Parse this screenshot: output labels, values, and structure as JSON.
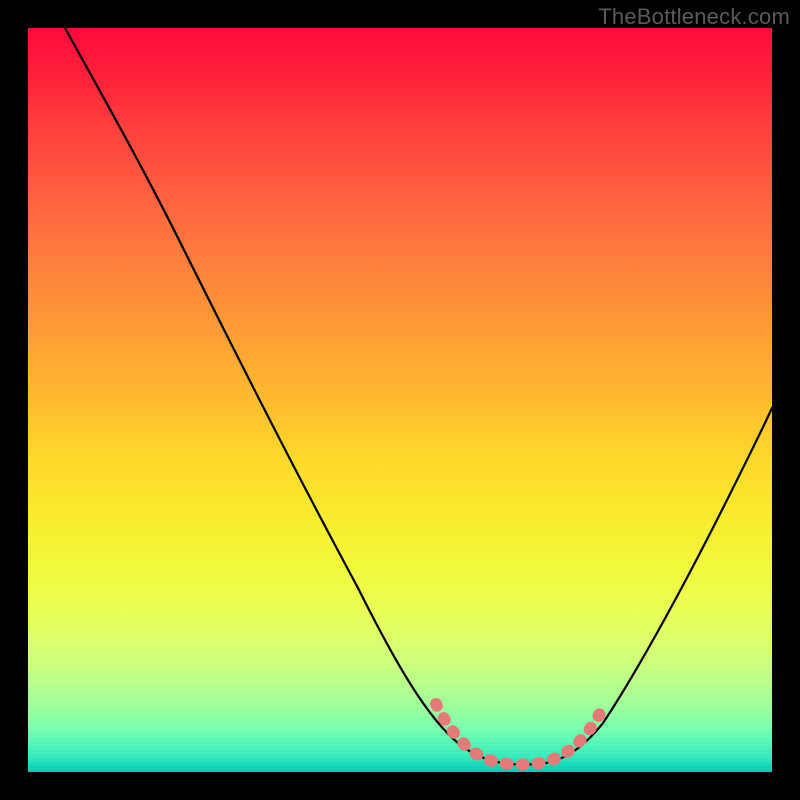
{
  "watermark": "TheBottleneck.com",
  "chart_data": {
    "type": "line",
    "title": "",
    "xlabel": "",
    "ylabel": "",
    "xlim": [
      0,
      100
    ],
    "ylim": [
      0,
      100
    ],
    "series": [
      {
        "name": "bottleneck-curve",
        "x": [
          5,
          10,
          16,
          22,
          28,
          34,
          40,
          46,
          52,
          56,
          58,
          60,
          62,
          65,
          68,
          71,
          74,
          78,
          82,
          86,
          90,
          94,
          98,
          100
        ],
        "values": [
          100,
          90,
          80,
          70,
          60,
          50,
          40,
          30,
          20,
          11,
          7,
          4.5,
          3,
          2,
          1.5,
          2,
          3,
          6,
          12,
          20,
          30,
          40,
          50,
          55
        ]
      }
    ],
    "highlight_segment": {
      "name": "optimal-range-marker",
      "x": [
        56,
        58,
        60,
        62,
        65,
        68,
        71,
        74,
        76
      ],
      "values": [
        10,
        6,
        4,
        3,
        2,
        2.5,
        3.5,
        5.5,
        8
      ]
    },
    "gradient_stops": [
      {
        "pos": 0.0,
        "color": "#ff0a3a"
      },
      {
        "pos": 0.3,
        "color": "#ff7a3e"
      },
      {
        "pos": 0.58,
        "color": "#ffd92a"
      },
      {
        "pos": 0.78,
        "color": "#eaff53"
      },
      {
        "pos": 0.91,
        "color": "#9fff99"
      },
      {
        "pos": 1.0,
        "color": "#00c9b6"
      }
    ]
  }
}
